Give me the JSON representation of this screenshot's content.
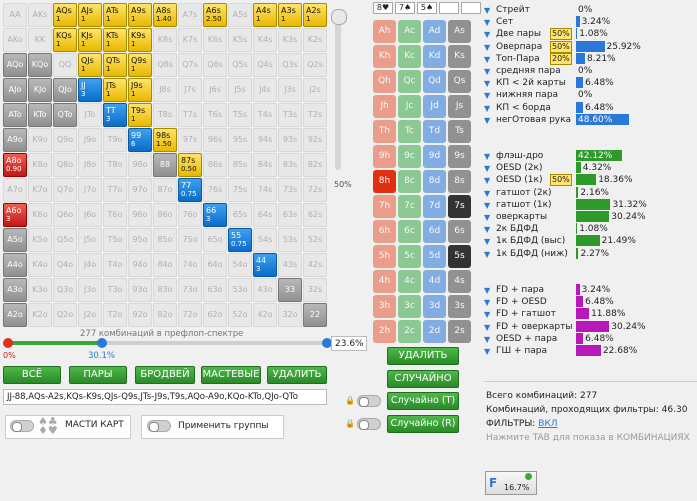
{
  "grid": [
    [
      {
        "t": "AA",
        "c": ""
      },
      {
        "t": "AKs",
        "c": ""
      },
      {
        "t": "AQs",
        "c": "sel",
        "w": "1"
      },
      {
        "t": "AJs",
        "c": "sel",
        "w": "1"
      },
      {
        "t": "ATs",
        "c": "sel",
        "w": "1"
      },
      {
        "t": "A9s",
        "c": "sel",
        "w": "1"
      },
      {
        "t": "A8s",
        "c": "sel",
        "w": "1.40"
      },
      {
        "t": "A7s",
        "c": ""
      },
      {
        "t": "A6s",
        "c": "sel",
        "w": "2.50"
      },
      {
        "t": "A5s",
        "c": ""
      },
      {
        "t": "A4s",
        "c": "sel",
        "w": "1"
      },
      {
        "t": "A3s",
        "c": "sel",
        "w": "1"
      },
      {
        "t": "A2s",
        "c": "sel",
        "w": "1"
      }
    ],
    [
      {
        "t": "AKo",
        "c": ""
      },
      {
        "t": "KK",
        "c": ""
      },
      {
        "t": "KQs",
        "c": "sel",
        "w": "1"
      },
      {
        "t": "KJs",
        "c": "sel",
        "w": "1"
      },
      {
        "t": "KTs",
        "c": "sel",
        "w": "1"
      },
      {
        "t": "K9s",
        "c": "sel",
        "w": "1"
      },
      {
        "t": "K8s",
        "c": ""
      },
      {
        "t": "K7s",
        "c": ""
      },
      {
        "t": "K6s",
        "c": ""
      },
      {
        "t": "K5s",
        "c": ""
      },
      {
        "t": "K4s",
        "c": ""
      },
      {
        "t": "K3s",
        "c": ""
      },
      {
        "t": "K2s",
        "c": ""
      }
    ],
    [
      {
        "t": "AQo",
        "c": "grey"
      },
      {
        "t": "KQo",
        "c": "grey"
      },
      {
        "t": "QQ",
        "c": ""
      },
      {
        "t": "QJs",
        "c": "sel",
        "w": "1"
      },
      {
        "t": "QTs",
        "c": "sel",
        "w": "1"
      },
      {
        "t": "Q9s",
        "c": "sel",
        "w": "1"
      },
      {
        "t": "Q8s",
        "c": ""
      },
      {
        "t": "Q7s",
        "c": ""
      },
      {
        "t": "Q6s",
        "c": ""
      },
      {
        "t": "Q5s",
        "c": ""
      },
      {
        "t": "Q4s",
        "c": ""
      },
      {
        "t": "Q3s",
        "c": ""
      },
      {
        "t": "Q2s",
        "c": ""
      }
    ],
    [
      {
        "t": "AJo",
        "c": "grey"
      },
      {
        "t": "KJo",
        "c": "grey"
      },
      {
        "t": "QJo",
        "c": "grey"
      },
      {
        "t": "JJ",
        "c": "blue",
        "w": "3"
      },
      {
        "t": "JTs",
        "c": "sel",
        "w": "1"
      },
      {
        "t": "J9s",
        "c": "sel",
        "w": "1"
      },
      {
        "t": "J8s",
        "c": ""
      },
      {
        "t": "J7s",
        "c": ""
      },
      {
        "t": "J6s",
        "c": ""
      },
      {
        "t": "J5s",
        "c": ""
      },
      {
        "t": "J4s",
        "c": ""
      },
      {
        "t": "J3s",
        "c": ""
      },
      {
        "t": "J2s",
        "c": ""
      }
    ],
    [
      {
        "t": "ATo",
        "c": "grey"
      },
      {
        "t": "KTo",
        "c": "grey"
      },
      {
        "t": "QTo",
        "c": "grey"
      },
      {
        "t": "JTo",
        "c": ""
      },
      {
        "t": "TT",
        "c": "blue",
        "w": "3"
      },
      {
        "t": "T9s",
        "c": "sel",
        "w": "1"
      },
      {
        "t": "T8s",
        "c": ""
      },
      {
        "t": "T7s",
        "c": ""
      },
      {
        "t": "T6s",
        "c": ""
      },
      {
        "t": "T5s",
        "c": ""
      },
      {
        "t": "T4s",
        "c": ""
      },
      {
        "t": "T3s",
        "c": ""
      },
      {
        "t": "T2s",
        "c": ""
      }
    ],
    [
      {
        "t": "A9o",
        "c": "grey"
      },
      {
        "t": "K9o",
        "c": ""
      },
      {
        "t": "Q9o",
        "c": ""
      },
      {
        "t": "J9o",
        "c": ""
      },
      {
        "t": "T9o",
        "c": ""
      },
      {
        "t": "99",
        "c": "blue",
        "w": "6"
      },
      {
        "t": "98s",
        "c": "sel",
        "w": "1.50"
      },
      {
        "t": "97s",
        "c": ""
      },
      {
        "t": "96s",
        "c": ""
      },
      {
        "t": "95s",
        "c": ""
      },
      {
        "t": "94s",
        "c": ""
      },
      {
        "t": "93s",
        "c": ""
      },
      {
        "t": "92s",
        "c": ""
      }
    ],
    [
      {
        "t": "A8o",
        "c": "red",
        "w": "0.90"
      },
      {
        "t": "K8o",
        "c": ""
      },
      {
        "t": "Q8o",
        "c": ""
      },
      {
        "t": "J8o",
        "c": ""
      },
      {
        "t": "T8o",
        "c": ""
      },
      {
        "t": "98o",
        "c": ""
      },
      {
        "t": "88",
        "c": "grey"
      },
      {
        "t": "87s",
        "c": "sel",
        "w": "0.50"
      },
      {
        "t": "86s",
        "c": ""
      },
      {
        "t": "85s",
        "c": ""
      },
      {
        "t": "84s",
        "c": ""
      },
      {
        "t": "83s",
        "c": ""
      },
      {
        "t": "82s",
        "c": ""
      }
    ],
    [
      {
        "t": "A7o",
        "c": ""
      },
      {
        "t": "K7o",
        "c": ""
      },
      {
        "t": "Q7o",
        "c": ""
      },
      {
        "t": "J7o",
        "c": ""
      },
      {
        "t": "T7o",
        "c": ""
      },
      {
        "t": "97o",
        "c": ""
      },
      {
        "t": "87o",
        "c": ""
      },
      {
        "t": "77",
        "c": "blue",
        "w": "0.75"
      },
      {
        "t": "76s",
        "c": ""
      },
      {
        "t": "75s",
        "c": ""
      },
      {
        "t": "74s",
        "c": ""
      },
      {
        "t": "73s",
        "c": ""
      },
      {
        "t": "72s",
        "c": ""
      }
    ],
    [
      {
        "t": "A6o",
        "c": "red",
        "w": "3"
      },
      {
        "t": "K6o",
        "c": ""
      },
      {
        "t": "Q6o",
        "c": ""
      },
      {
        "t": "J6o",
        "c": ""
      },
      {
        "t": "T6o",
        "c": ""
      },
      {
        "t": "96o",
        "c": ""
      },
      {
        "t": "86o",
        "c": ""
      },
      {
        "t": "76o",
        "c": ""
      },
      {
        "t": "66",
        "c": "blue",
        "w": "3"
      },
      {
        "t": "65s",
        "c": ""
      },
      {
        "t": "64s",
        "c": ""
      },
      {
        "t": "63s",
        "c": ""
      },
      {
        "t": "62s",
        "c": ""
      }
    ],
    [
      {
        "t": "A5o",
        "c": "grey"
      },
      {
        "t": "K5o",
        "c": ""
      },
      {
        "t": "Q5o",
        "c": ""
      },
      {
        "t": "J5o",
        "c": ""
      },
      {
        "t": "T5o",
        "c": ""
      },
      {
        "t": "95o",
        "c": ""
      },
      {
        "t": "85o",
        "c": ""
      },
      {
        "t": "75o",
        "c": ""
      },
      {
        "t": "65o",
        "c": ""
      },
      {
        "t": "55",
        "c": "blue",
        "w": "0.75"
      },
      {
        "t": "54s",
        "c": ""
      },
      {
        "t": "53s",
        "c": ""
      },
      {
        "t": "52s",
        "c": ""
      }
    ],
    [
      {
        "t": "A4o",
        "c": "grey"
      },
      {
        "t": "K4o",
        "c": ""
      },
      {
        "t": "Q4o",
        "c": ""
      },
      {
        "t": "J4o",
        "c": ""
      },
      {
        "t": "T4o",
        "c": ""
      },
      {
        "t": "94o",
        "c": ""
      },
      {
        "t": "84o",
        "c": ""
      },
      {
        "t": "74o",
        "c": ""
      },
      {
        "t": "64o",
        "c": ""
      },
      {
        "t": "54o",
        "c": ""
      },
      {
        "t": "44",
        "c": "blue",
        "w": "3"
      },
      {
        "t": "43s",
        "c": ""
      },
      {
        "t": "42s",
        "c": ""
      }
    ],
    [
      {
        "t": "A3o",
        "c": "grey"
      },
      {
        "t": "K3o",
        "c": ""
      },
      {
        "t": "Q3o",
        "c": ""
      },
      {
        "t": "J3o",
        "c": ""
      },
      {
        "t": "T3o",
        "c": ""
      },
      {
        "t": "93o",
        "c": ""
      },
      {
        "t": "83o",
        "c": ""
      },
      {
        "t": "73o",
        "c": ""
      },
      {
        "t": "63o",
        "c": ""
      },
      {
        "t": "53o",
        "c": ""
      },
      {
        "t": "43o",
        "c": ""
      },
      {
        "t": "33",
        "c": "grey"
      },
      {
        "t": "32s",
        "c": ""
      }
    ],
    [
      {
        "t": "A2o",
        "c": "grey"
      },
      {
        "t": "K2o",
        "c": ""
      },
      {
        "t": "Q2o",
        "c": ""
      },
      {
        "t": "J2o",
        "c": ""
      },
      {
        "t": "T2o",
        "c": ""
      },
      {
        "t": "92o",
        "c": ""
      },
      {
        "t": "82o",
        "c": ""
      },
      {
        "t": "72o",
        "c": ""
      },
      {
        "t": "62o",
        "c": ""
      },
      {
        "t": "52o",
        "c": ""
      },
      {
        "t": "42o",
        "c": ""
      },
      {
        "t": "32o",
        "c": ""
      },
      {
        "t": "22",
        "c": "grey"
      }
    ]
  ],
  "vslider_pct": "50%",
  "board": [
    "8♥",
    "7♠",
    "5♠"
  ],
  "board_grid": [
    [
      "Ah",
      "Ac",
      "Ad",
      "As"
    ],
    [
      "Kh",
      "Kc",
      "Kd",
      "Ks"
    ],
    [
      "Qh",
      "Qc",
      "Qd",
      "Qs"
    ],
    [
      "Jh",
      "Jc",
      "Jd",
      "Js"
    ],
    [
      "Th",
      "Tc",
      "Td",
      "Ts"
    ],
    [
      "9h",
      "9c",
      "9d",
      "9s"
    ],
    [
      "8h",
      "8c",
      "8d",
      "8s"
    ],
    [
      "7h",
      "7c",
      "7d",
      "7s"
    ],
    [
      "6h",
      "6c",
      "6d",
      "6s"
    ],
    [
      "5h",
      "5c",
      "5d",
      "5s"
    ],
    [
      "4h",
      "4c",
      "4d",
      "4s"
    ],
    [
      "3h",
      "3c",
      "3d",
      "3s"
    ],
    [
      "2h",
      "2c",
      "2d",
      "2s"
    ]
  ],
  "combos_label": "277 комбинаций в префлоп-спектре",
  "slider_start_pct": "0%",
  "slider_pos_pct": "30.1%",
  "slider_right_pct": "23.6%",
  "range_buttons": [
    "ВСЁ",
    "ПАРЫ",
    "БРОДВЕЙ",
    "МАСТЕВЫЕ",
    "УДАЛИТЬ"
  ],
  "range_text": "JJ-88,AQs-A2s,KQs-K9s,QJs-Q9s,JTs-J9s,T9s,AQo-A9o,KQo-KTo,QJo-QTo",
  "suits_label": "МАСТИ КАРТ",
  "groups_label": "Применить группы",
  "right_buttons": {
    "delete": "УДАЛИТЬ",
    "random": "СЛУЧАЙНО",
    "random_t": "Случайно (T)",
    "random_r": "Случайно (R)"
  },
  "stats1": [
    {
      "label": "Стрейт",
      "val": "0%",
      "pct": 0
    },
    {
      "label": "Сет",
      "val": "3.24%",
      "pct": 3.24
    },
    {
      "label": "Две пары",
      "val": "1.08%",
      "pct": 1.08,
      "badge": "50%"
    },
    {
      "label": "Оверпара",
      "val": "25.92%",
      "pct": 25.92,
      "badge": "50%"
    },
    {
      "label": "Топ-Пара",
      "val": "8.21%",
      "pct": 8.21,
      "badge": "20%"
    },
    {
      "label": "средняя пара",
      "val": "0%",
      "pct": 0
    },
    {
      "label": "КП < 2й карты",
      "val": "6.48%",
      "pct": 6.48
    },
    {
      "label": "нижняя пара",
      "val": "0%",
      "pct": 0
    },
    {
      "label": "КП < борда",
      "val": "6.48%",
      "pct": 6.48
    },
    {
      "label": "негОтовая рука",
      "val": "48.60%",
      "pct": 48.6
    }
  ],
  "stats2": [
    {
      "label": "флэш-дро",
      "val": "42.12%",
      "pct": 42.12
    },
    {
      "label": "OESD (2к)",
      "val": "4.32%",
      "pct": 4.32
    },
    {
      "label": "OESD (1к)",
      "val": "18.36%",
      "pct": 18.36,
      "badge": "50%"
    },
    {
      "label": "гатшот (2к)",
      "val": "2.16%",
      "pct": 2.16
    },
    {
      "label": "гатшот (1к)",
      "val": "31.32%",
      "pct": 31.32
    },
    {
      "label": "оверкарты",
      "val": "30.24%",
      "pct": 30.24
    },
    {
      "label": "2к БДФД",
      "val": "1.08%",
      "pct": 1.08
    },
    {
      "label": "1к БДФД (выс)",
      "val": "21.49%",
      "pct": 21.49
    },
    {
      "label": "1к БДФД (ниж)",
      "val": "2.27%",
      "pct": 2.27
    }
  ],
  "stats3": [
    {
      "label": "FD + пара",
      "val": "3.24%",
      "pct": 3.24
    },
    {
      "label": "FD + OESD",
      "val": "6.48%",
      "pct": 6.48
    },
    {
      "label": "FD + гатшот",
      "val": "11.88%",
      "pct": 11.88
    },
    {
      "label": "FD + оверкарты",
      "val": "30.24%",
      "pct": 30.24
    },
    {
      "label": "OESD + пара",
      "val": "6.48%",
      "pct": 6.48
    },
    {
      "label": "ГШ + пара",
      "val": "22.68%",
      "pct": 22.68
    }
  ],
  "summary": {
    "total": "Всего комбинаций: 277",
    "passing": "Комбинаций, проходящих фильтры: 46.30",
    "filters_label": "ФИЛЬТРЫ:",
    "filters_state": "ВКЛ",
    "hint": "Нажмите TAB для показа в КОМБИНАЦИЯХ"
  },
  "filter_badge": "16.7%",
  "colors": {
    "blue": "#2a78d8",
    "green": "#2e9a2a",
    "purple": "#b818b8"
  }
}
